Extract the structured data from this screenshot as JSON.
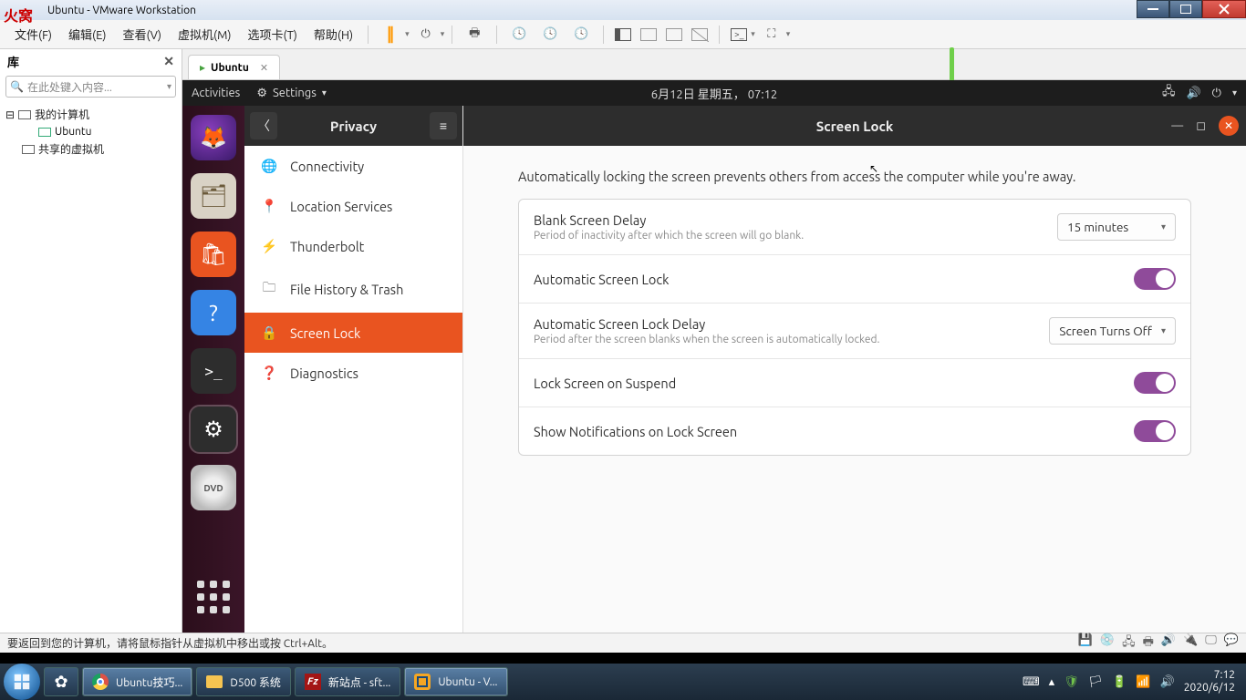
{
  "window": {
    "title": "Ubuntu - VMware Workstation",
    "watermark": "火窝"
  },
  "vm_menu": {
    "file": "文件(F)",
    "edit": "编辑(E)",
    "view": "查看(V)",
    "vm": "虚拟机(M)",
    "tabs": "选项卡(T)",
    "help": "帮助(H)"
  },
  "library": {
    "title": "库",
    "search_placeholder": "在此处键入内容...",
    "root": "我的计算机",
    "child": "Ubuntu",
    "shared": "共享的虚拟机"
  },
  "tab": {
    "name": "Ubuntu"
  },
  "gnome": {
    "activities": "Activities",
    "app": "Settings",
    "clock": "6月12日 星期五， 07:12"
  },
  "privacy": {
    "header": "Privacy",
    "items": {
      "connectivity": "Connectivity",
      "location": "Location Services",
      "thunderbolt": "Thunderbolt",
      "filehist": "File History & Trash",
      "screenlock": "Screen Lock",
      "diagnostics": "Diagnostics"
    }
  },
  "screenlock": {
    "title": "Screen Lock",
    "desc": "Automatically locking the screen prevents others from access the computer while you're away.",
    "blank_title": "Blank Screen Delay",
    "blank_sub": "Period of inactivity after which the screen will go blank.",
    "blank_value": "15 minutes",
    "auto_title": "Automatic Screen Lock",
    "delay_title": "Automatic Screen Lock Delay",
    "delay_sub": "Period after the screen blanks when the screen is automatically locked.",
    "delay_value": "Screen Turns Off",
    "suspend": "Lock Screen on Suspend",
    "notif": "Show Notifications on Lock Screen"
  },
  "vm_status": {
    "hint": "要返回到您的计算机，请将鼠标指针从虚拟机中移出或按 Ctrl+Alt。"
  },
  "taskbar": {
    "chrome": "Ubuntu技巧...",
    "folder": "D500 系统",
    "fz": "新站点 - sft...",
    "vm": "Ubuntu - V...",
    "time": "7:12",
    "date": "2020/6/12"
  }
}
